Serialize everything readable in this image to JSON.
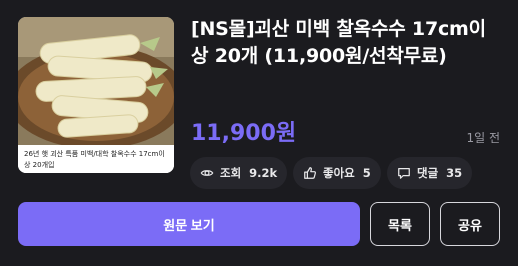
{
  "item": {
    "title": "[NS몰]괴산 미백 찰옥수수 17cm이상 20개 (11,900원/선착무료)",
    "price": "11,900원",
    "time_ago": "1일 전",
    "thumbnail_caption": "26년 햇 괴산 특품 미백/대학 찰옥수수 17cm이상 20개입"
  },
  "stats": {
    "views": {
      "label": "조회",
      "value": "9.2k",
      "icon": "eye-icon"
    },
    "likes": {
      "label": "좋아요",
      "value": "5",
      "icon": "thumbs-up-icon"
    },
    "comments": {
      "label": "댓글",
      "value": "35",
      "icon": "comment-icon"
    }
  },
  "actions": {
    "view_original": "원문 보기",
    "list": "목록",
    "share": "공유"
  },
  "colors": {
    "accent": "#7b6cf6",
    "background": "#1b1b1f",
    "chip": "#26262c"
  }
}
